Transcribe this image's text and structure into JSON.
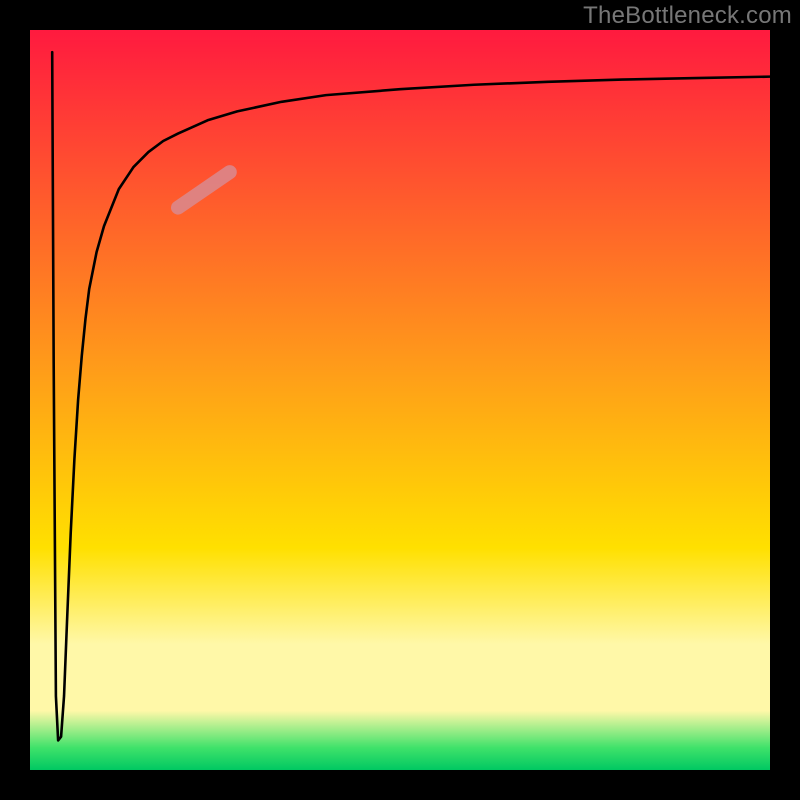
{
  "watermark": "TheBottleneck.com",
  "chart_data": {
    "type": "line",
    "title": "",
    "xlabel": "",
    "ylabel": "",
    "xlim": [
      0,
      100
    ],
    "ylim": [
      0,
      100
    ],
    "grid": false,
    "legend": false,
    "background_gradient": {
      "stops": [
        {
          "pos": 0.0,
          "color": "#ff1a3f"
        },
        {
          "pos": 0.45,
          "color": "#ff9a1a"
        },
        {
          "pos": 0.7,
          "color": "#ffe000"
        },
        {
          "pos": 0.83,
          "color": "#fff8a8"
        },
        {
          "pos": 0.92,
          "color": "#fff8a8"
        },
        {
          "pos": 0.97,
          "color": "#3fe26a"
        },
        {
          "pos": 1.0,
          "color": "#00c862"
        }
      ]
    },
    "series": [
      {
        "name": "curve",
        "color": "#000000",
        "x": [
          3.0,
          3.2,
          3.5,
          3.8,
          4.2,
          4.6,
          5.0,
          5.5,
          6.0,
          6.5,
          7.0,
          7.5,
          8.0,
          9.0,
          10.0,
          12.0,
          14.0,
          16.0,
          18.0,
          20.0,
          24.0,
          28.0,
          34.0,
          40.0,
          50.0,
          60.0,
          70.0,
          80.0,
          90.0,
          100.0
        ],
        "y": [
          97.0,
          55.0,
          10.0,
          4.0,
          4.5,
          10.0,
          20.0,
          32.0,
          42.0,
          50.0,
          56.0,
          61.0,
          65.0,
          70.0,
          73.5,
          78.5,
          81.5,
          83.5,
          85.0,
          86.0,
          87.8,
          89.0,
          90.3,
          91.2,
          92.0,
          92.6,
          93.0,
          93.3,
          93.5,
          93.7
        ]
      }
    ],
    "annotations": [
      {
        "name": "pink-blob",
        "type": "segment",
        "color": "#d98a8f",
        "x": [
          20.0,
          27.0
        ],
        "y": [
          76.0,
          80.8
        ]
      }
    ],
    "start_spike": {
      "x": 3.0,
      "y_from": 97.0
    }
  }
}
